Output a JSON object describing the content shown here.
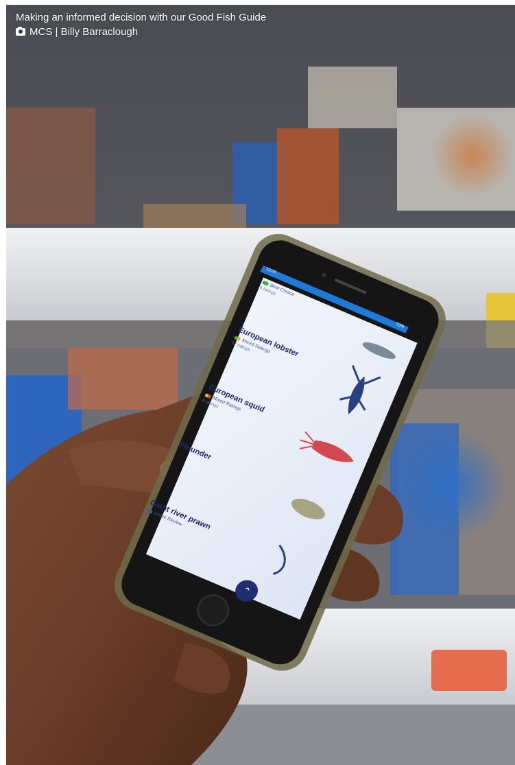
{
  "caption": {
    "title": "Making an informed decision with our Good Fish Guide",
    "credit": "MCS | Billy Barraclough",
    "credit_icon": "camera-icon"
  },
  "app": {
    "status": {
      "time": "12:00",
      "battery": "53%"
    },
    "items": [
      {
        "name": "",
        "rating": "Best Choice",
        "rating_color": "#2fb34a",
        "count": "6 ratings"
      },
      {
        "name": "European lobster",
        "rating": "Mixed Ratings",
        "rating_color": "#e8b12e",
        "count": "17 ratings"
      },
      {
        "name": "European squid",
        "rating": "Mixed Ratings",
        "rating_color": "#e8b12e",
        "count": "6 ratings"
      },
      {
        "name": "Flounder",
        "rating": "",
        "rating_color": "#2fb34a",
        "count": ""
      },
      {
        "name": "Giant river prawn",
        "rating": "Under Review",
        "rating_color": "#4a5aa0",
        "count": ""
      }
    ],
    "scroll_up_icon": "chevron-up-icon"
  },
  "colors": {
    "accent": "#1e7ad6",
    "text_navy": "#1d2a6b",
    "screen_bg": "#e9eef8"
  }
}
